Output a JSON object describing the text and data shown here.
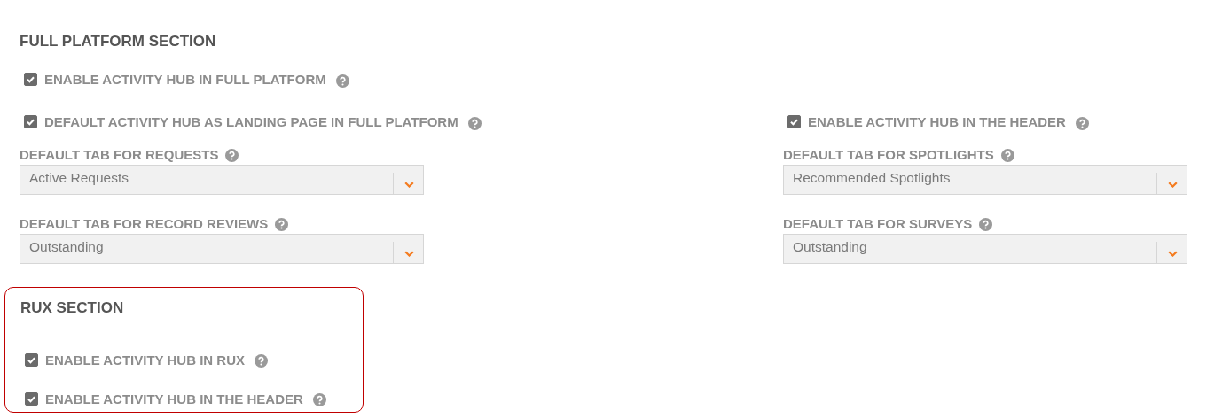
{
  "full_platform": {
    "title": "FULL PLATFORM SECTION",
    "rows": [
      {
        "left": {
          "kind": "checkbox",
          "label": "ENABLE ACTIVITY HUB IN FULL PLATFORM",
          "checked": true
        }
      },
      {
        "left": {
          "kind": "checkbox",
          "label": "DEFAULT ACTIVITY HUB AS LANDING PAGE IN FULL PLATFORM",
          "checked": true
        },
        "right": {
          "kind": "checkbox",
          "label": "ENABLE ACTIVITY HUB IN THE HEADER",
          "checked": true
        }
      },
      {
        "left": {
          "kind": "select",
          "label": "DEFAULT TAB FOR REQUESTS",
          "value": "Active Requests"
        },
        "right": {
          "kind": "select",
          "label": "DEFAULT TAB FOR SPOTLIGHTS",
          "value": "Recommended Spotlights"
        }
      },
      {
        "left": {
          "kind": "select",
          "label": "DEFAULT TAB FOR RECORD REVIEWS",
          "value": "Outstanding"
        },
        "right": {
          "kind": "select",
          "label": "DEFAULT TAB FOR SURVEYS",
          "value": "Outstanding"
        }
      }
    ]
  },
  "rux": {
    "title": "RUX SECTION",
    "items": [
      {
        "kind": "checkbox",
        "label": "ENABLE ACTIVITY HUB IN RUX",
        "checked": true
      },
      {
        "kind": "checkbox",
        "label": "ENABLE ACTIVITY HUB IN THE HEADER",
        "checked": true
      }
    ]
  }
}
